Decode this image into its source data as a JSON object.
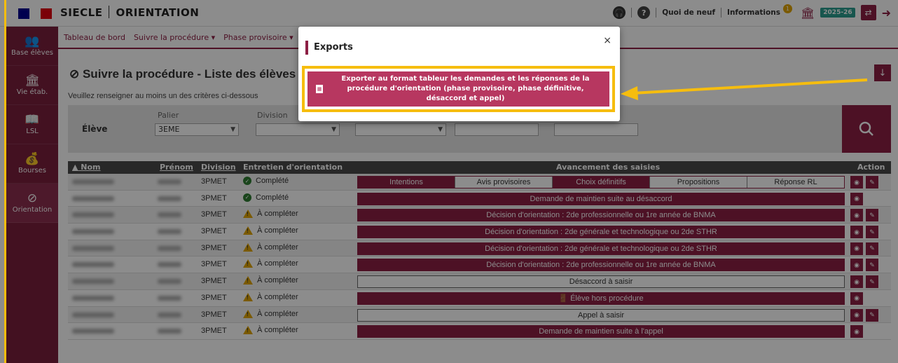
{
  "app": {
    "brand_left": "SIECLE",
    "brand_right": "ORIENTATION"
  },
  "topbar": {
    "help_icon": "?",
    "whats_new": "Quoi de neuf",
    "informations": "Informations",
    "info_badge": "1",
    "year": "2025-26"
  },
  "sidebar": [
    {
      "icon": "people-icon",
      "label": "Base élèves"
    },
    {
      "icon": "building-icon",
      "label": "Vie étab."
    },
    {
      "icon": "book-icon",
      "label": "LSL"
    },
    {
      "icon": "bag-icon",
      "label": "Bourses"
    },
    {
      "icon": "compass-icon",
      "label": "Orientation"
    }
  ],
  "subnav": [
    "Tableau de bord",
    "Suivre la procédure ▾",
    "Phase provisoire ▾",
    "Ph"
  ],
  "page": {
    "title": "Suivre la procédure - Liste des élèves",
    "hint": "Veuillez renseigner au moins un des critères ci-dessous"
  },
  "filters": {
    "eleve_label": "Élève",
    "palier_label": "Palier",
    "palier_value": "3EME",
    "division_label": "Division"
  },
  "table": {
    "headers": {
      "nom": "▲ Nom",
      "prenom": "Prénom",
      "division": "Division",
      "entretien": "Entretien d'orientation",
      "avancement": "Avancement des saisies",
      "action": "Action"
    },
    "progress_steps": [
      "Intentions",
      "Avis provisoires",
      "Choix définitifs",
      "Propositions",
      "Réponse RL"
    ],
    "rows": [
      {
        "division": "3PMET",
        "status": "Complété",
        "ok": true,
        "type": "steps",
        "edit": true
      },
      {
        "division": "3PMET",
        "status": "Complété",
        "ok": true,
        "type": "fill",
        "text": "Demande de maintien suite au désaccord",
        "edit": false
      },
      {
        "division": "3PMET",
        "status": "À compléter",
        "ok": false,
        "type": "fill",
        "text": "Décision d'orientation : 2de professionnelle ou 1re année de BNMA",
        "edit": true
      },
      {
        "division": "3PMET",
        "status": "À compléter",
        "ok": false,
        "type": "fill",
        "text": "Décision d'orientation : 2de générale et technologique ou 2de STHR",
        "edit": true
      },
      {
        "division": "3PMET",
        "status": "À compléter",
        "ok": false,
        "type": "fill",
        "text": "Décision d'orientation : 2de générale et technologique ou 2de STHR",
        "edit": true
      },
      {
        "division": "3PMET",
        "status": "À compléter",
        "ok": false,
        "type": "fill",
        "text": "Décision d'orientation : 2de professionnelle ou 1re année de BNMA",
        "edit": true
      },
      {
        "division": "3PMET",
        "status": "À compléter",
        "ok": false,
        "type": "empty",
        "text": "Désaccord à saisir",
        "edit": true
      },
      {
        "division": "3PMET",
        "status": "À compléter",
        "ok": false,
        "type": "fill",
        "text": "Élève hors procédure",
        "edit": false
      },
      {
        "division": "3PMET",
        "status": "À compléter",
        "ok": false,
        "type": "empty",
        "text": "Appel à saisir",
        "edit": true
      },
      {
        "division": "3PMET",
        "status": "À compléter",
        "ok": false,
        "type": "fill",
        "text": "Demande de maintien suite à l'appel",
        "edit": false
      }
    ]
  },
  "modal": {
    "title": "Exports",
    "close": "×",
    "export_text": "Exporter au format tableur les demandes et les réponses de la procédure d'orientation (phase provisoire, phase définitive, désaccord et appel)"
  },
  "colors": {
    "primary": "#8c1f44",
    "highlight": "#f6bd0e",
    "button": "#b73760"
  }
}
